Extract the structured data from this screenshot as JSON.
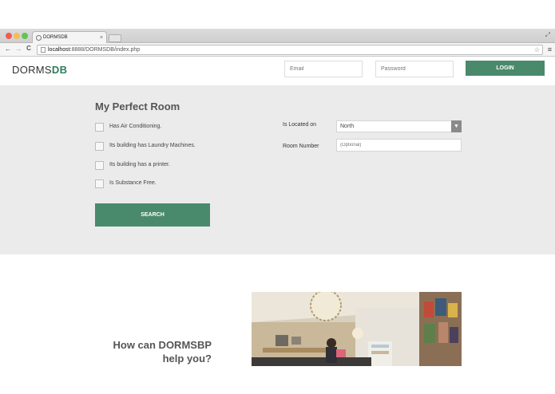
{
  "browser": {
    "tab_title": "DORMSDB",
    "tab_close": "×",
    "url_host": "localhost",
    "url_path": ":8888/DORMSDB/index.php",
    "fullscreen_glyph": "⤢",
    "star_glyph": "☆",
    "menu_glyph": "≡",
    "back_glyph": "←",
    "forward_glyph": "→",
    "reload_glyph": "C",
    "traffic_lights": {
      "close": "#ee5c54",
      "minimize": "#f5bd4f",
      "zoom": "#5fc453"
    }
  },
  "header": {
    "logo_light": "DORMS",
    "logo_bold": "DB",
    "email_placeholder": "Email",
    "password_placeholder": "Password",
    "login_label": "LOGIN"
  },
  "search": {
    "title": "My Perfect Room",
    "amenities": [
      {
        "label": "Has Air Conditioning."
      },
      {
        "label": "Its building has Laundry Machines."
      },
      {
        "label": "Its building has a printer."
      },
      {
        "label": "Is Substance Free."
      }
    ],
    "location_label": "Is Located on",
    "location_value": "North",
    "room_label": "Room Number",
    "room_placeholder": "(Optional)",
    "search_label": "SEARCH"
  },
  "help": {
    "line1": "How can DORMSBP",
    "line2": "help you?"
  },
  "colors": {
    "brand_green": "#4a8a6c",
    "logo_green": "#2e7d5a",
    "panel_gray": "#ebebeb"
  }
}
